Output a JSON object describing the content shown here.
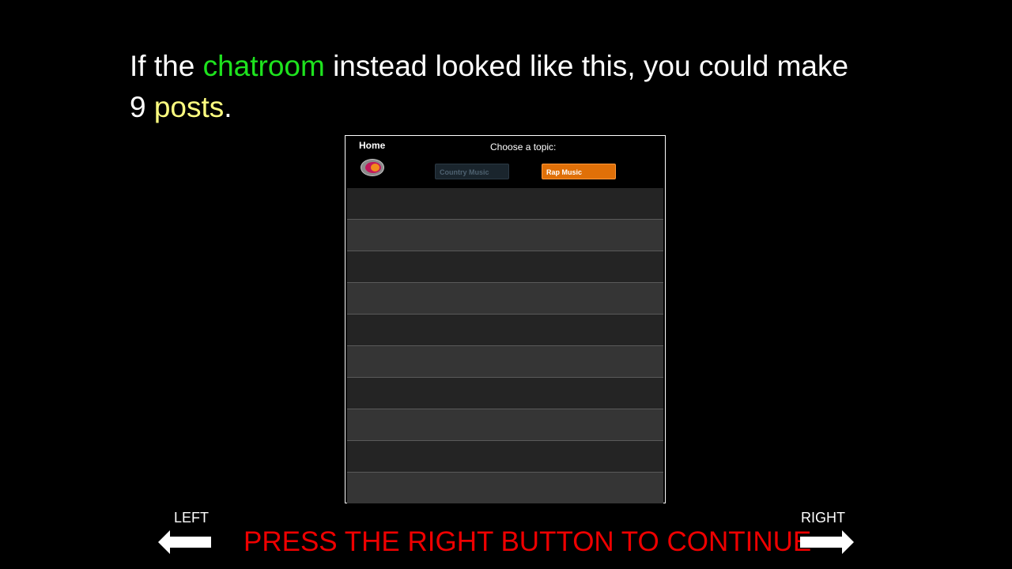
{
  "headline": {
    "part1": "If the ",
    "highlight_chatroom": "chatroom",
    "part2": " instead looked like this, you could make",
    "part3": "9 ",
    "highlight_posts": "posts",
    "part4": "."
  },
  "chatroom": {
    "home_label": "Home",
    "topic_prompt": "Choose a topic:",
    "topics": [
      {
        "label": "Country Music",
        "state": "inactive"
      },
      {
        "label": "Rap Music",
        "state": "active"
      }
    ],
    "post_slot_count": 10
  },
  "navigation": {
    "left_label": "LEFT",
    "right_label": "RIGHT",
    "instruction": "PRESS THE RIGHT BUTTON TO CONTINUE"
  },
  "colors": {
    "highlight_green": "#1ee31e",
    "highlight_yellow": "#ffff80",
    "instruction_red": "#ee0000",
    "rap_button": "#e07008"
  }
}
